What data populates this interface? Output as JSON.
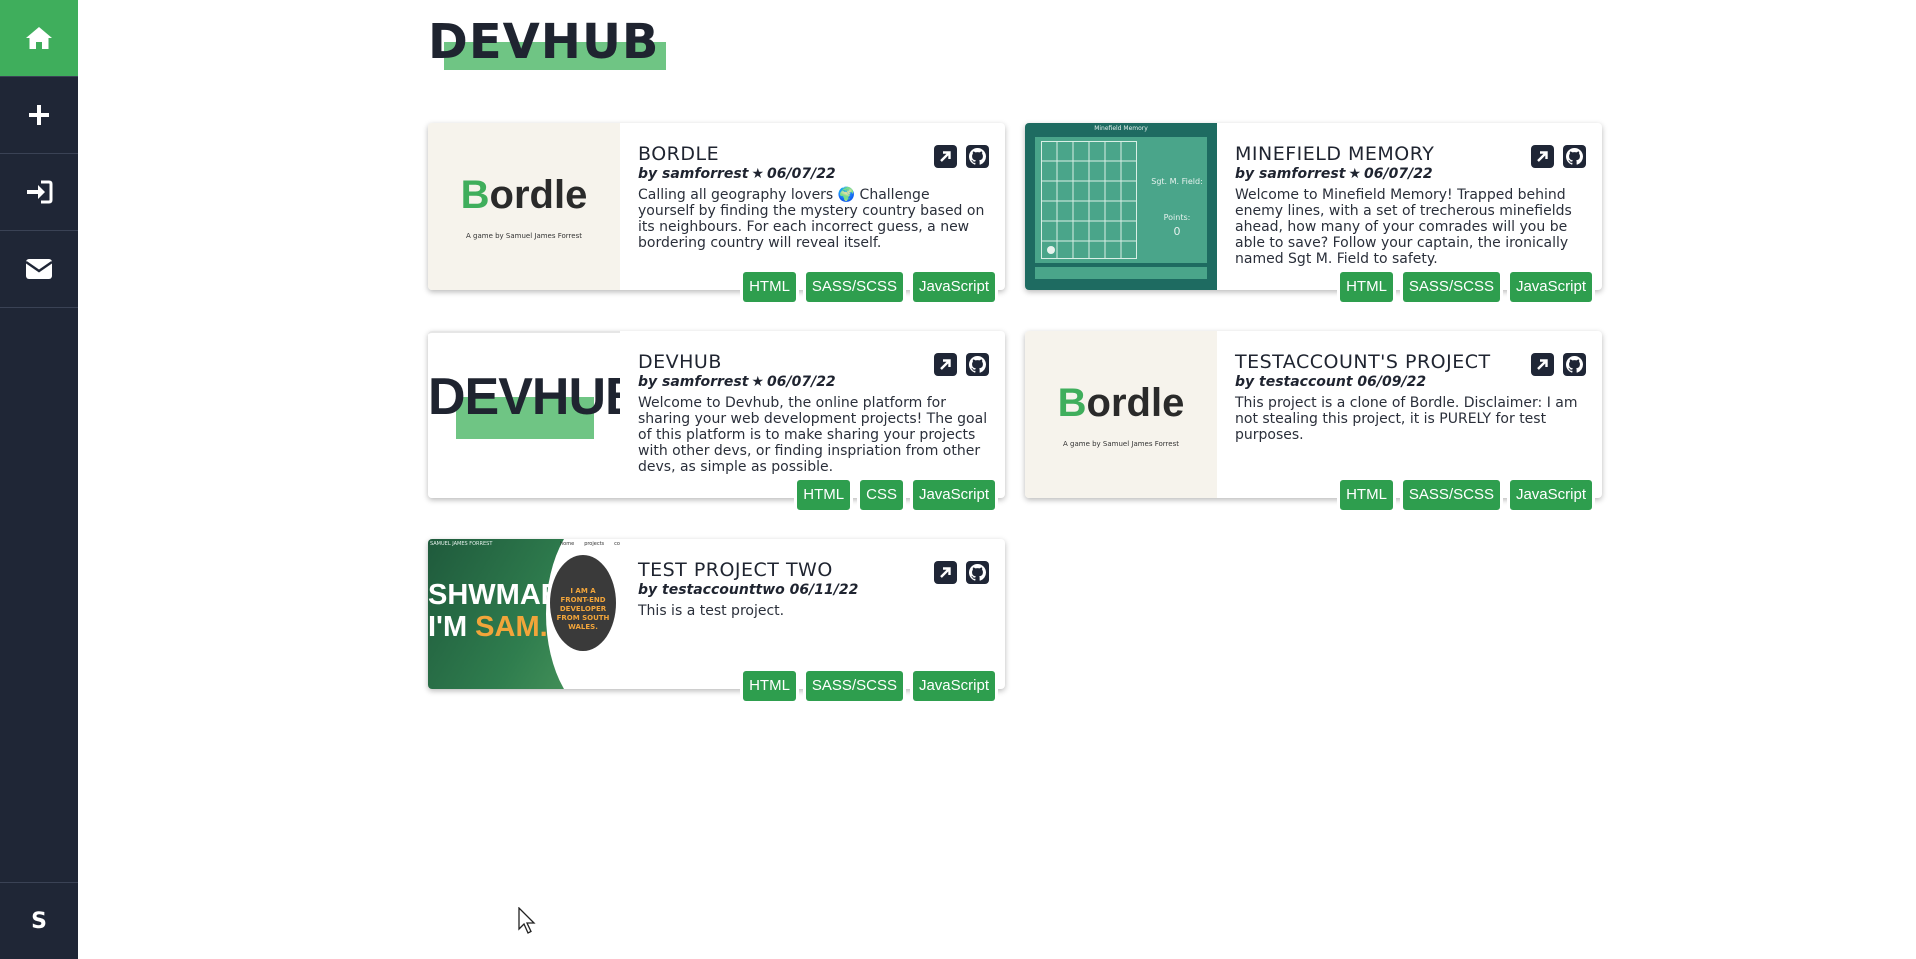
{
  "sidebar": {
    "items": [
      {
        "icon": "home-icon"
      },
      {
        "icon": "plus-icon"
      },
      {
        "icon": "login-icon"
      },
      {
        "icon": "mail-icon"
      }
    ],
    "user_initial": "S"
  },
  "logo": "DEVHUB",
  "colors": {
    "sidebar": "#1f2636",
    "accent": "#3fae5c",
    "tag": "#2e9e4e"
  },
  "projects": [
    {
      "title": "BORDLE",
      "author": "by samforrest",
      "starred": true,
      "date": "06/07/22",
      "description": "Calling all geography lovers 🌍 Challenge yourself by finding the mystery country based on its neighbours. For each incorrect guess, a new bordering country will reveal itself.",
      "tags": [
        "HTML",
        "SASS/SCSS",
        "JavaScript"
      ],
      "thumb": {
        "logo": "Bordle",
        "sub": "A game by Samuel James Forrest"
      }
    },
    {
      "title": "MINEFIELD MEMORY",
      "author": "by samforrest",
      "starred": true,
      "date": "06/07/22",
      "description": "Welcome to Minefield Memory! Trapped behind enemy lines, with a set of trecherous minefields ahead, how many of your comrades will you be able to save? Follow your captain, the ironically named Sgt M. Field to safety.",
      "tags": [
        "HTML",
        "SASS/SCSS",
        "JavaScript"
      ],
      "thumb": {
        "header": "Minefield Memory",
        "name": "Sgt. M. Field:",
        "points_label": "Points:",
        "points": "0"
      }
    },
    {
      "title": "DEVHUB",
      "author": "by samforrest",
      "starred": true,
      "date": "06/07/22",
      "description": "Welcome to Devhub, the online platform for sharing your web development projects! The goal of this platform is to make sharing your projects with other devs, or finding inspriation from other devs, as simple as possible.",
      "tags": [
        "HTML",
        "CSS",
        "JavaScript"
      ],
      "thumb": {
        "logo": "DEVHUB"
      }
    },
    {
      "title": "TESTACCOUNT'S PROJECT",
      "author": "by testaccount",
      "starred": false,
      "date": "06/09/22",
      "description": "This project is a clone of Bordle. Disclaimer: I am not stealing this project, it is PURELY for test purposes.",
      "tags": [
        "HTML",
        "SASS/SCSS",
        "JavaScript"
      ],
      "thumb": {
        "logo": "Bordle",
        "sub": "A game by Samuel James Forrest"
      }
    },
    {
      "title": "TEST PROJECT TWO",
      "author": "by testaccounttwo",
      "starred": false,
      "date": "06/11/22",
      "description": "This is a test project.",
      "tags": [
        "HTML",
        "SASS/SCSS",
        "JavaScript"
      ],
      "thumb": {
        "brand": "SAMUEL JAMES FORREST",
        "nav": [
          "home",
          "projects",
          "contact"
        ],
        "line1": "SHWMAE,",
        "line2a": "I'M ",
        "line2b": "SAM.",
        "circle": "I AM A FRONT-END DEVELOPER FROM SOUTH WALES."
      }
    }
  ]
}
